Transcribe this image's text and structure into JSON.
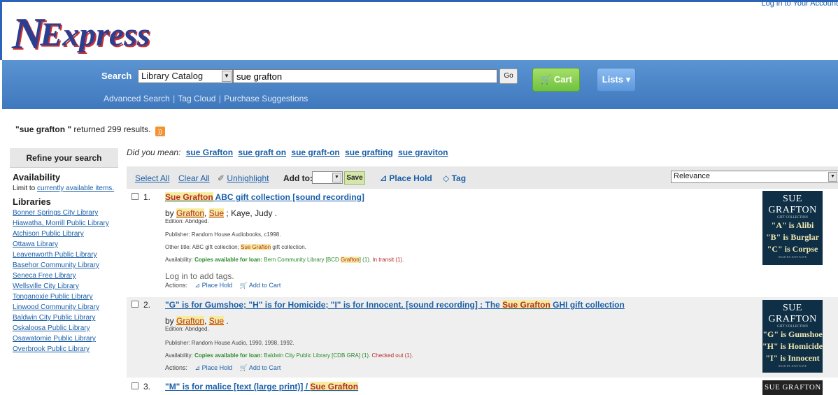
{
  "header": {
    "logo_n": "N",
    "logo_rest": "Express",
    "login_link": "Log in to Your Account"
  },
  "search": {
    "label": "Search",
    "scope": "Library Catalog",
    "query": "sue grafton",
    "go_label": "Go",
    "cart_label": "Cart",
    "lists_label": "Lists ▾",
    "links": [
      "Advanced Search",
      "Tag Cloud",
      "Purchase Suggestions"
    ]
  },
  "summary": {
    "query": "\"sue grafton \"",
    "text": "returned 299 results."
  },
  "sidebar": {
    "refine_header": "Refine your search",
    "availability_heading": "Availability",
    "limit_text": "Limit to",
    "limit_link": "currently available items.",
    "libraries_heading": "Libraries",
    "libraries": [
      "Bonner Springs City Library",
      "Hiawatha, Morrill Public Library",
      "Atchison Public Library",
      "Ottawa Library",
      "Leavenworth Public Library",
      "Basehor Community Library",
      "Seneca Free Library",
      "Wellsville City Library",
      "Tonganoxie Public Library",
      "Linwood Community Library",
      "Baldwin City Public Library",
      "Oskaloosa Public Library",
      "Osawatomie Public Library",
      "Overbrook Public Library"
    ]
  },
  "didyoumean": {
    "label": "Did you mean:",
    "suggestions": [
      "sue Grafton",
      "sue graft on",
      "sue graft-on",
      "sue grafting",
      "sue graviton"
    ]
  },
  "toolbar": {
    "select_all": "Select All",
    "clear_all": "Clear All",
    "unhighlight": "Unhighlight",
    "add_to": "Add to:",
    "save": "Save",
    "place_hold": "Place Hold",
    "tag": "Tag",
    "sort": "Relevance"
  },
  "results": [
    {
      "num": "1.",
      "title_hl": "Sue Grafton",
      "title_rest": " ABC gift collection [sound recording]",
      "by_prefix": "by ",
      "author_last": "Grafton",
      "author_first": "Sue",
      "by_rest": " ; Kaye, Judy .",
      "edition": "Edition: Abridged.",
      "publisher": "Publisher: Random House Audiobooks, c1998.",
      "other_title_pre": "Other title: ABC gift collection; ",
      "other_title_hl": "Sue Grafton",
      "other_title_post": " gift collection.",
      "avail_label": "Availability: ",
      "avail_bold": "Copies available for loan:",
      "avail_text": " Bern Community Library [BCD ",
      "avail_hl": "Grafton",
      "avail_end": "] (1).",
      "avail_status": " In transit (1).",
      "login_tags": "Log in to add tags.",
      "actions_label": "Actions:",
      "action_hold": "Place Hold",
      "action_cart": "Add to Cart",
      "cover_top": "SUE GRAFTON",
      "cover_sub": "GIFT COLLECTION",
      "cover_lines": [
        "\"A\" is Alibi",
        "\"B\" is Burglar",
        "\"C\" is Corpse"
      ],
      "cover_foot": "READ BY JUDY KAYE"
    },
    {
      "num": "2.",
      "title_pre": "\"G\" is for Gumshoe; \"H\" is for Homicide; \"I\" is for Innocent. [sound recording] : The ",
      "title_hl": "Sue Grafton",
      "title_rest": " GHI gift collection",
      "by_prefix": "by ",
      "author_last": "Grafton",
      "author_first": "Sue",
      "by_rest": " .",
      "edition": "Edition: Abridged.",
      "publisher": "Publisher: Random House Audio, 1990, 1998, 1992.",
      "avail_label": "Availability: ",
      "avail_bold": "Copies available for loan:",
      "avail_text": " Baldwin City Public Library [CDB GRA] (1).",
      "avail_status": " Checked out (1).",
      "actions_label": "Actions:",
      "action_hold": "Place Hold",
      "action_cart": "Add to Cart",
      "cover_top": "SUE GRAFTON",
      "cover_sub": "GIFT COLLECTION",
      "cover_lines": [
        "\"G\" is Gumshoe",
        "\"H\" is Homicide",
        "\"I\" is Innocent"
      ],
      "cover_foot": "READ BY JUDY KAYE"
    },
    {
      "num": "3.",
      "title_pre": "\"M\" is for malice [text (large print)] / ",
      "title_hl": "Sue Grafton",
      "cover_top": "SUE GRAFTON"
    }
  ]
}
